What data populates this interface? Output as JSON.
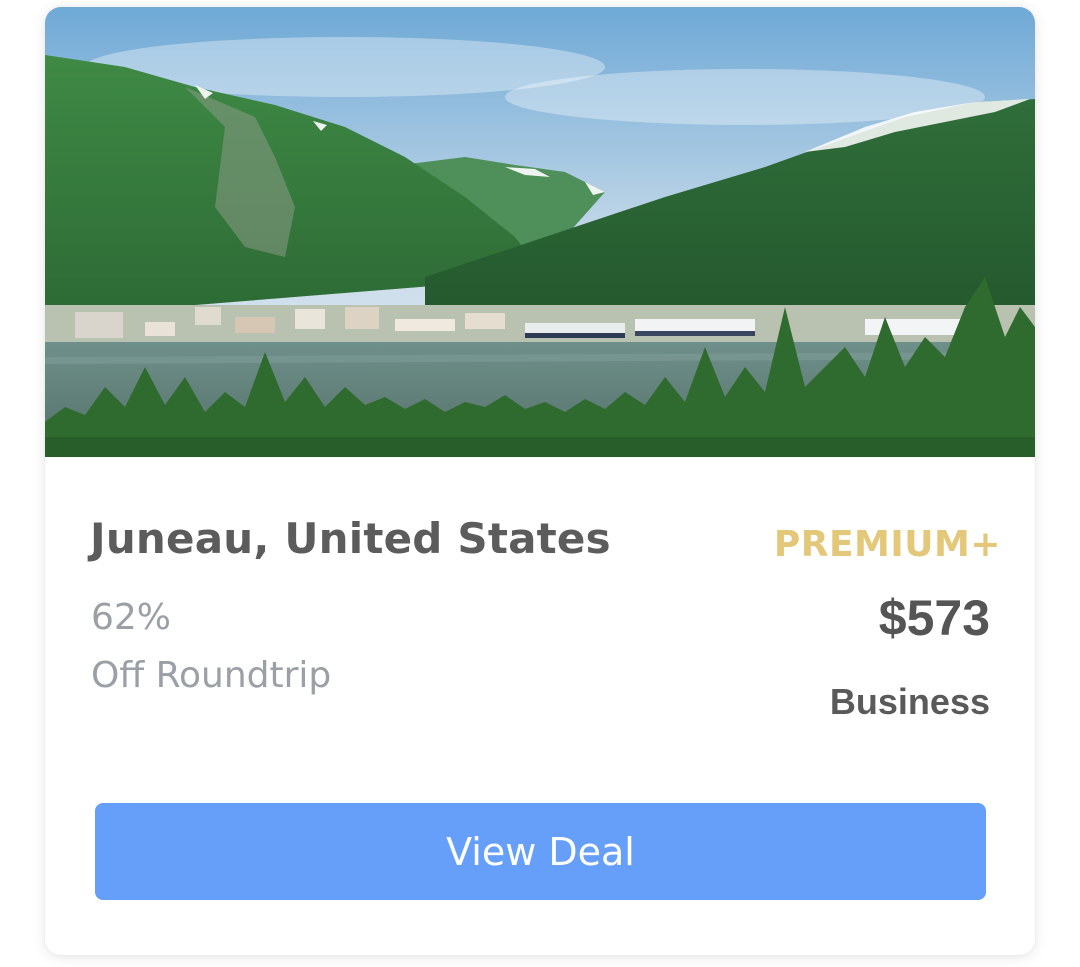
{
  "deal": {
    "city": "Juneau, United States",
    "discount": "62%",
    "trip_type": "Off Roundtrip",
    "tier": "PREMIUM+",
    "price": "$573",
    "cabin": "Business",
    "cta_label": "View Deal"
  },
  "colors": {
    "tier": "#e3c87a",
    "button": "#659ffa",
    "title": "#5c5c5c",
    "muted": "#9aa0a6"
  },
  "image": {
    "subject": "mountain-harbor-town-photo"
  }
}
